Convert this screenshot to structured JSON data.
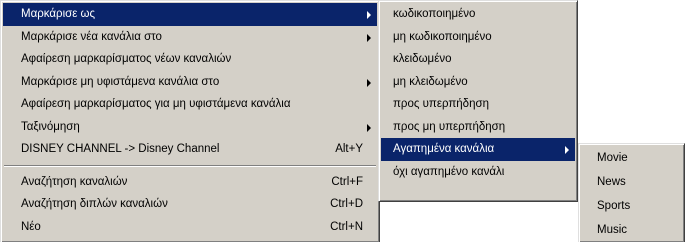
{
  "main_menu": {
    "items": [
      {
        "label": "Μαρκάρισε ως",
        "selected": true,
        "submenu": true,
        "shortcut": ""
      },
      {
        "label": "Μαρκάρισε νέα κανάλια στο",
        "submenu": true,
        "shortcut": ""
      },
      {
        "label": "Αφαίρεση μαρκαρίσματος νέων καναλιών",
        "submenu": false,
        "shortcut": ""
      },
      {
        "label": "Μαρκάρισε μη υφιστάμενα κανάλια στο",
        "submenu": true,
        "shortcut": ""
      },
      {
        "label": "Αφαίρεση μαρκαρίσματος για μη υφιστάμενα κανάλια",
        "submenu": false,
        "shortcut": ""
      },
      {
        "label": "Ταξινόμηση",
        "submenu": true,
        "shortcut": ""
      },
      {
        "label": "DISNEY CHANNEL -> Disney Channel",
        "submenu": false,
        "shortcut": "Alt+Y"
      },
      {
        "label": "Αναζήτηση καναλιών",
        "submenu": false,
        "shortcut": "Ctrl+F"
      },
      {
        "label": "Αναζήτηση διπλών καναλιών",
        "submenu": false,
        "shortcut": "Ctrl+D"
      },
      {
        "label": "Νέο",
        "submenu": false,
        "shortcut": "Ctrl+N"
      }
    ]
  },
  "mark_as_menu": {
    "items": [
      {
        "label": "κωδικοποιημένο"
      },
      {
        "label": "μη κωδικοποιημένο"
      },
      {
        "label": "κλειδωμένο"
      },
      {
        "label": "μη κλειδωμένο"
      },
      {
        "label": "προς υπερπήδηση"
      },
      {
        "label": "προς μη υπερπήδηση"
      },
      {
        "label": "Αγαπημένα κανάλια",
        "selected": true,
        "submenu": true
      },
      {
        "label": "όχι αγαπημένο κανάλι"
      }
    ]
  },
  "favorites_menu": {
    "items": [
      {
        "label": "Movie"
      },
      {
        "label": "News"
      },
      {
        "label": "Sports"
      },
      {
        "label": "Music"
      }
    ]
  },
  "colors": {
    "menu_background": "#d4d0c8",
    "selection_background": "#0a246a",
    "selection_text": "#ffffff"
  },
  "icons": {
    "submenu_arrow": "submenu-arrow-icon"
  }
}
